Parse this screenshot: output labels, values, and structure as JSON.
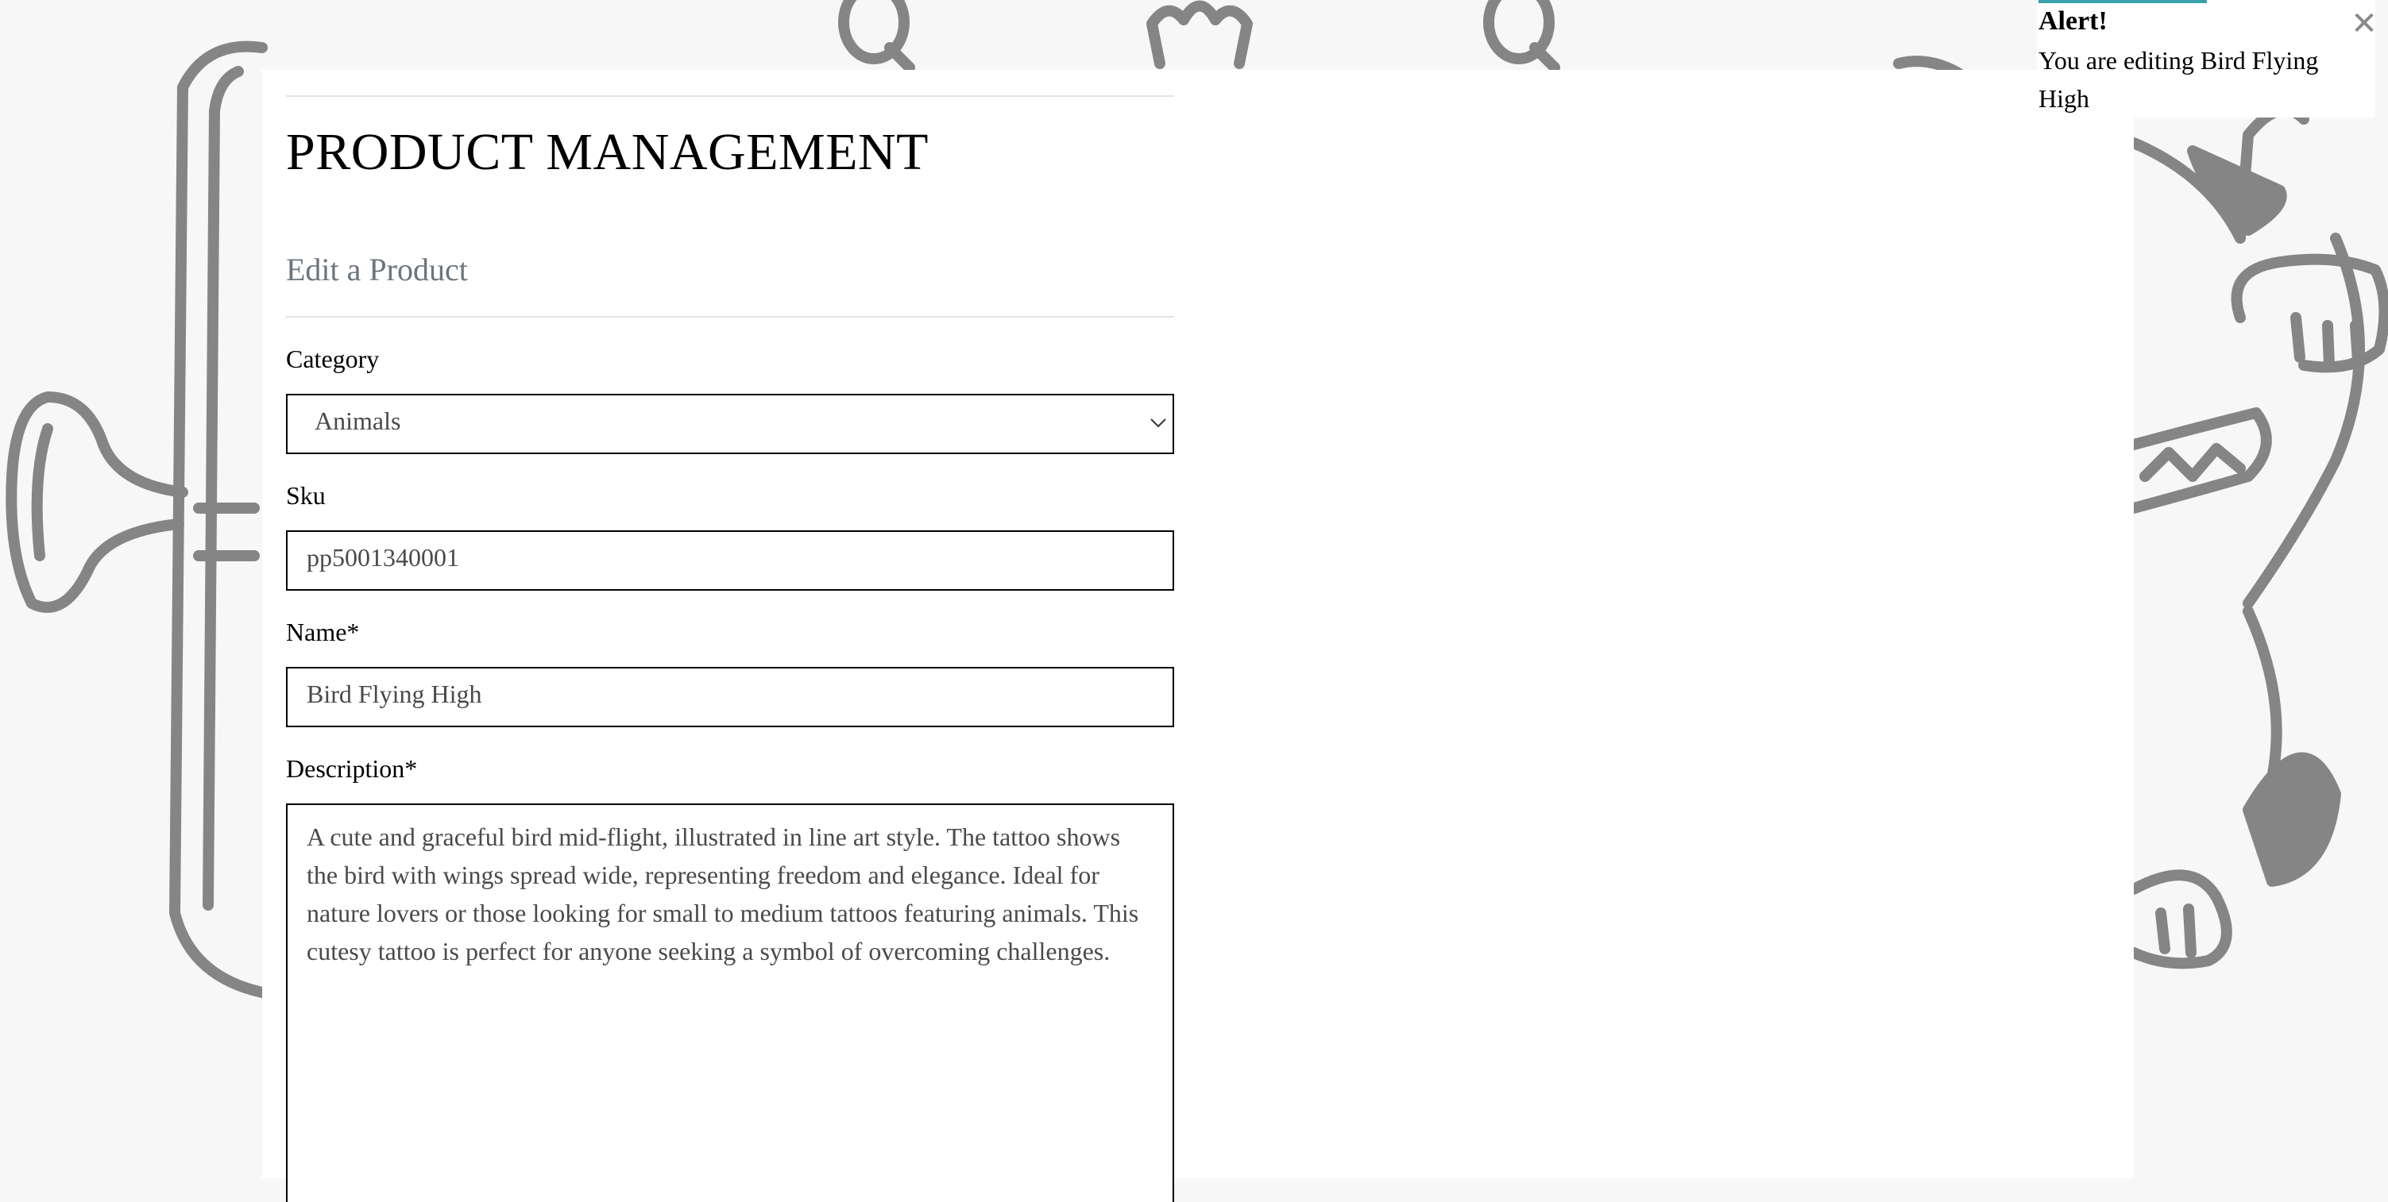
{
  "header": {
    "title": "PRODUCT MANAGEMENT"
  },
  "form": {
    "section_title": "Edit a Product",
    "category": {
      "label": "Category",
      "value": "Animals"
    },
    "sku": {
      "label": "Sku",
      "value": "pp5001340001"
    },
    "name": {
      "label": "Name*",
      "value": "Bird Flying High"
    },
    "description": {
      "label": "Description*",
      "value": "A cute and graceful bird mid-flight, illustrated in line art style. The tattoo shows the bird with wings spread wide, representing freedom and elegance. Ideal for nature lovers or those looking for small to medium tattoos featuring animals. This cutesy tattoo is perfect for anyone seeking a symbol of overcoming challenges."
    }
  },
  "alert": {
    "title": "Alert!",
    "message": "You are editing Bird Flying High",
    "close_icon": "close-icon",
    "accent_color": "#3aa0ad"
  },
  "background": {
    "art": "tattoo-line-art-illustration",
    "line_color": "#858585"
  }
}
